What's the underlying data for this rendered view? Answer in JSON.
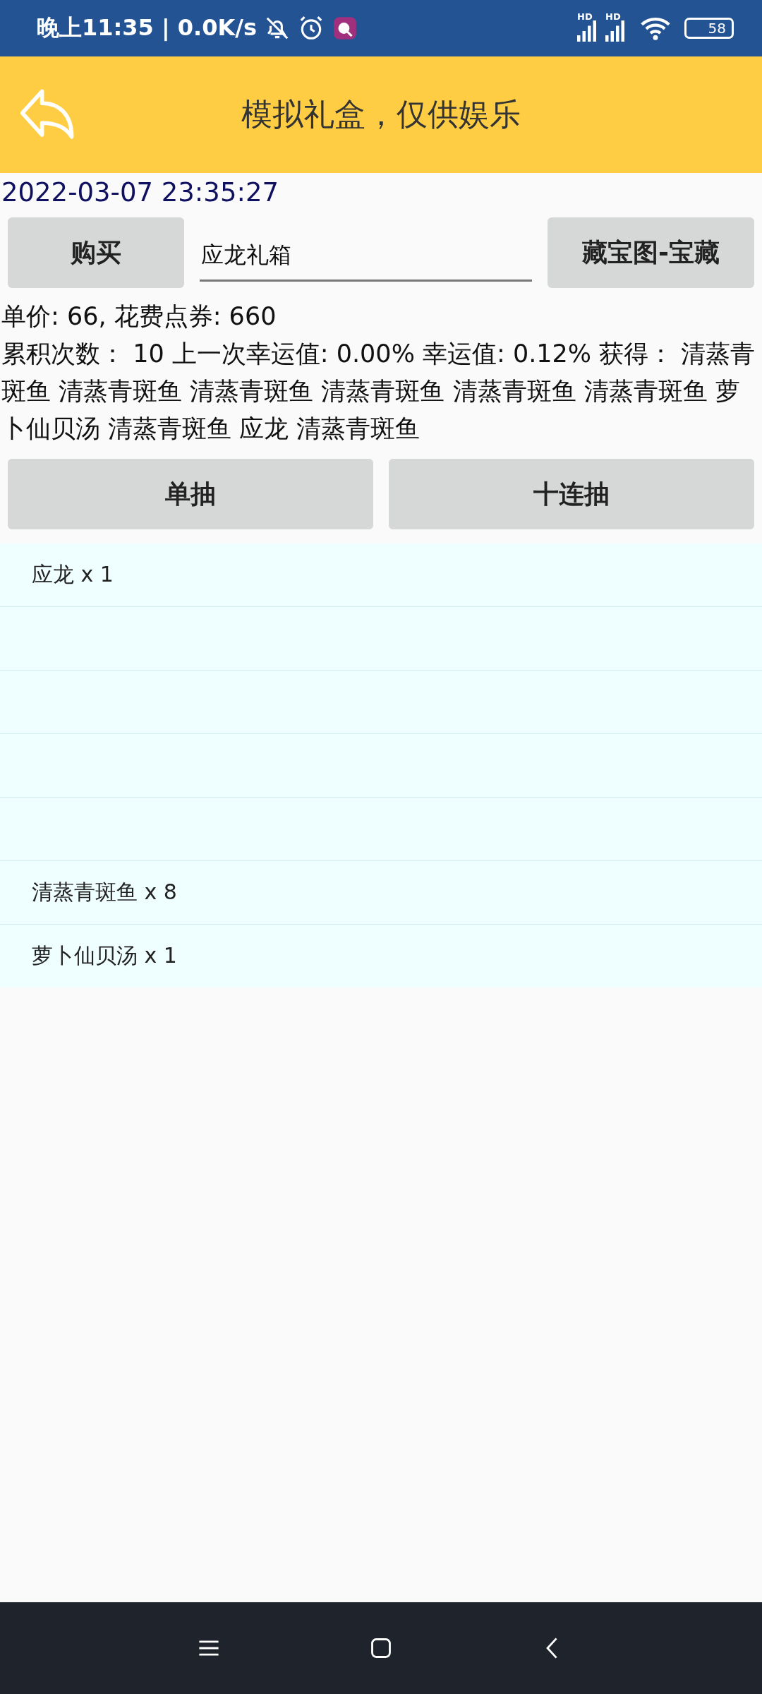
{
  "status_bar": {
    "time": "晚上11:35 | 0.0K/s",
    "signal_labels": [
      "HD",
      "HD"
    ],
    "battery": "58"
  },
  "header": {
    "title": "模拟礼盒，仅供娱乐"
  },
  "timestamp": "2022-03-07 23:35:27",
  "purchase": {
    "buy_button": "购买",
    "box_field": {
      "value": "应龙礼箱"
    },
    "treasure_button": "藏宝图-宝藏"
  },
  "price_line": "单价: 66, 花费点券: 660",
  "result_text": "累积次数： 10 上一次幸运值: 0.00% 幸运值: 0.12% 获得： 清蒸青斑鱼 清蒸青斑鱼 清蒸青斑鱼 清蒸青斑鱼 清蒸青斑鱼 清蒸青斑鱼 萝卜仙贝汤 清蒸青斑鱼 应龙 清蒸青斑鱼",
  "draw_buttons": [
    "单抽",
    "十连抽"
  ],
  "items": [
    {
      "kind": "item",
      "text": "应龙 x 1"
    },
    {
      "kind": "empty"
    },
    {
      "kind": "empty"
    },
    {
      "kind": "empty"
    },
    {
      "kind": "empty"
    },
    {
      "kind": "item",
      "text": "清蒸青斑鱼 x 8"
    },
    {
      "kind": "item",
      "text": "萝卜仙贝汤 x 1"
    }
  ]
}
